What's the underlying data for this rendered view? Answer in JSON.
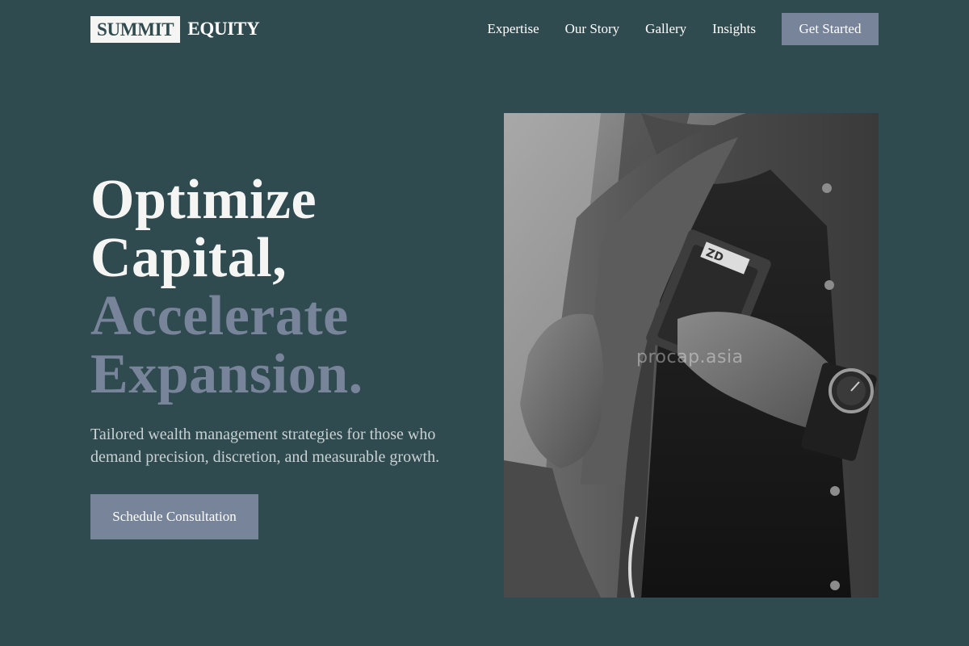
{
  "brand": {
    "box_word": "SUMMIT",
    "word": "EQUITY"
  },
  "nav": {
    "links": [
      "Expertise",
      "Our Story",
      "Gallery",
      "Insights"
    ],
    "cta": "Get Started"
  },
  "hero": {
    "heading_lines": [
      "Optimize",
      "Capital,"
    ],
    "heading_accent_lines": [
      "Accelerate",
      "Expansion."
    ],
    "subtitle": "Tailored wealth management strategies for those who demand precision, discretion, and measurable growth.",
    "button": "Schedule Consultation"
  },
  "image": {
    "subject": "man in suit placing card wallet in jacket pocket",
    "watermark": "procap.asia",
    "wallet_tag": "ZD"
  },
  "colors": {
    "background": "#2f4b50",
    "accent": "#778499",
    "text": "#ffffff",
    "subtitle": "#c9d1d3"
  }
}
